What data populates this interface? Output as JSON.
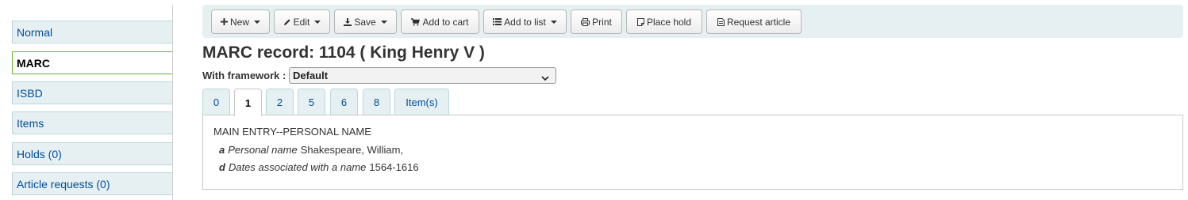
{
  "sidebar": {
    "items": [
      {
        "label": "Normal",
        "active": false
      },
      {
        "label": "MARC",
        "active": true
      },
      {
        "label": "ISBD",
        "active": false
      },
      {
        "label": "Items",
        "active": false
      },
      {
        "label": "Holds (0)",
        "active": false
      },
      {
        "label": "Article requests (0)",
        "active": false
      }
    ]
  },
  "toolbar": {
    "new": "New",
    "edit": "Edit",
    "save": "Save",
    "add_to_cart": "Add to cart",
    "add_to_list": "Add to list",
    "print": "Print",
    "place_hold": "Place hold",
    "request_article": "Request article"
  },
  "page": {
    "title": "MARC record: 1104 ( King Henry V )",
    "framework_label": "With framework :",
    "framework_value": "Default"
  },
  "tabs": [
    "0",
    "1",
    "2",
    "5",
    "6",
    "8",
    "Item(s)"
  ],
  "active_tab": "1",
  "panel": {
    "field_title": "MAIN ENTRY--PERSONAL NAME",
    "subfields": [
      {
        "code": "a",
        "label": "Personal name",
        "value": "Shakespeare, William,"
      },
      {
        "code": "d",
        "label": "Dates associated with a name",
        "value": "1564-1616"
      }
    ]
  },
  "colors": {
    "accent_bg": "#e6f0f2",
    "link": "#004d99",
    "active_border": "#6aae3a"
  }
}
